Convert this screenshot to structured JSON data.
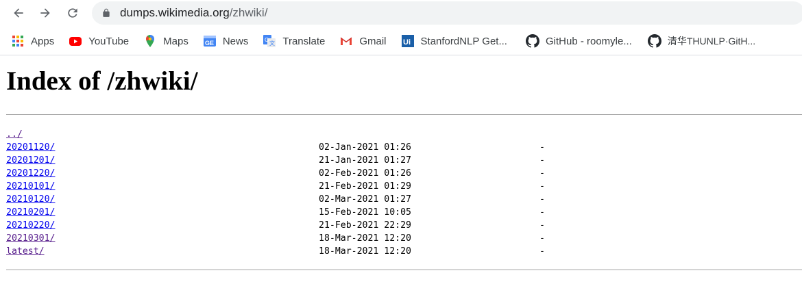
{
  "browser": {
    "url_host": "dumps.wikimedia.org",
    "url_path": "/zhwiki/",
    "bookmarks": [
      {
        "label": "Apps",
        "icon": "apps-grid-icon"
      },
      {
        "label": "YouTube",
        "icon": "youtube-icon"
      },
      {
        "label": "Maps",
        "icon": "maps-pin-icon"
      },
      {
        "label": "News",
        "icon": "news-icon"
      },
      {
        "label": "Translate",
        "icon": "translate-icon"
      },
      {
        "label": "Gmail",
        "icon": "gmail-icon"
      },
      {
        "label": "StanfordNLP Get...",
        "icon": "stanford-ui-icon"
      },
      {
        "label": "GitHub - roomyle...",
        "icon": "github-icon"
      },
      {
        "label": "清华THUNLP·GitH...",
        "icon": "github-icon"
      }
    ]
  },
  "page": {
    "title": "Index of /zhwiki/",
    "parent_link": "../",
    "entries": [
      {
        "name": "20201120/",
        "date": "02-Jan-2021 01:26",
        "size": "-",
        "visited": false
      },
      {
        "name": "20201201/",
        "date": "21-Jan-2021 01:27",
        "size": "-",
        "visited": false
      },
      {
        "name": "20201220/",
        "date": "02-Feb-2021 01:26",
        "size": "-",
        "visited": false
      },
      {
        "name": "20210101/",
        "date": "21-Feb-2021 01:29",
        "size": "-",
        "visited": false
      },
      {
        "name": "20210120/",
        "date": "02-Mar-2021 01:27",
        "size": "-",
        "visited": false
      },
      {
        "name": "20210201/",
        "date": "15-Feb-2021 10:05",
        "size": "-",
        "visited": false
      },
      {
        "name": "20210220/",
        "date": "21-Feb-2021 22:29",
        "size": "-",
        "visited": false
      },
      {
        "name": "20210301/",
        "date": "18-Mar-2021 12:20",
        "size": "-",
        "visited": true
      },
      {
        "name": "latest/",
        "date": "18-Mar-2021 12:20",
        "size": "-",
        "visited": true
      }
    ]
  }
}
